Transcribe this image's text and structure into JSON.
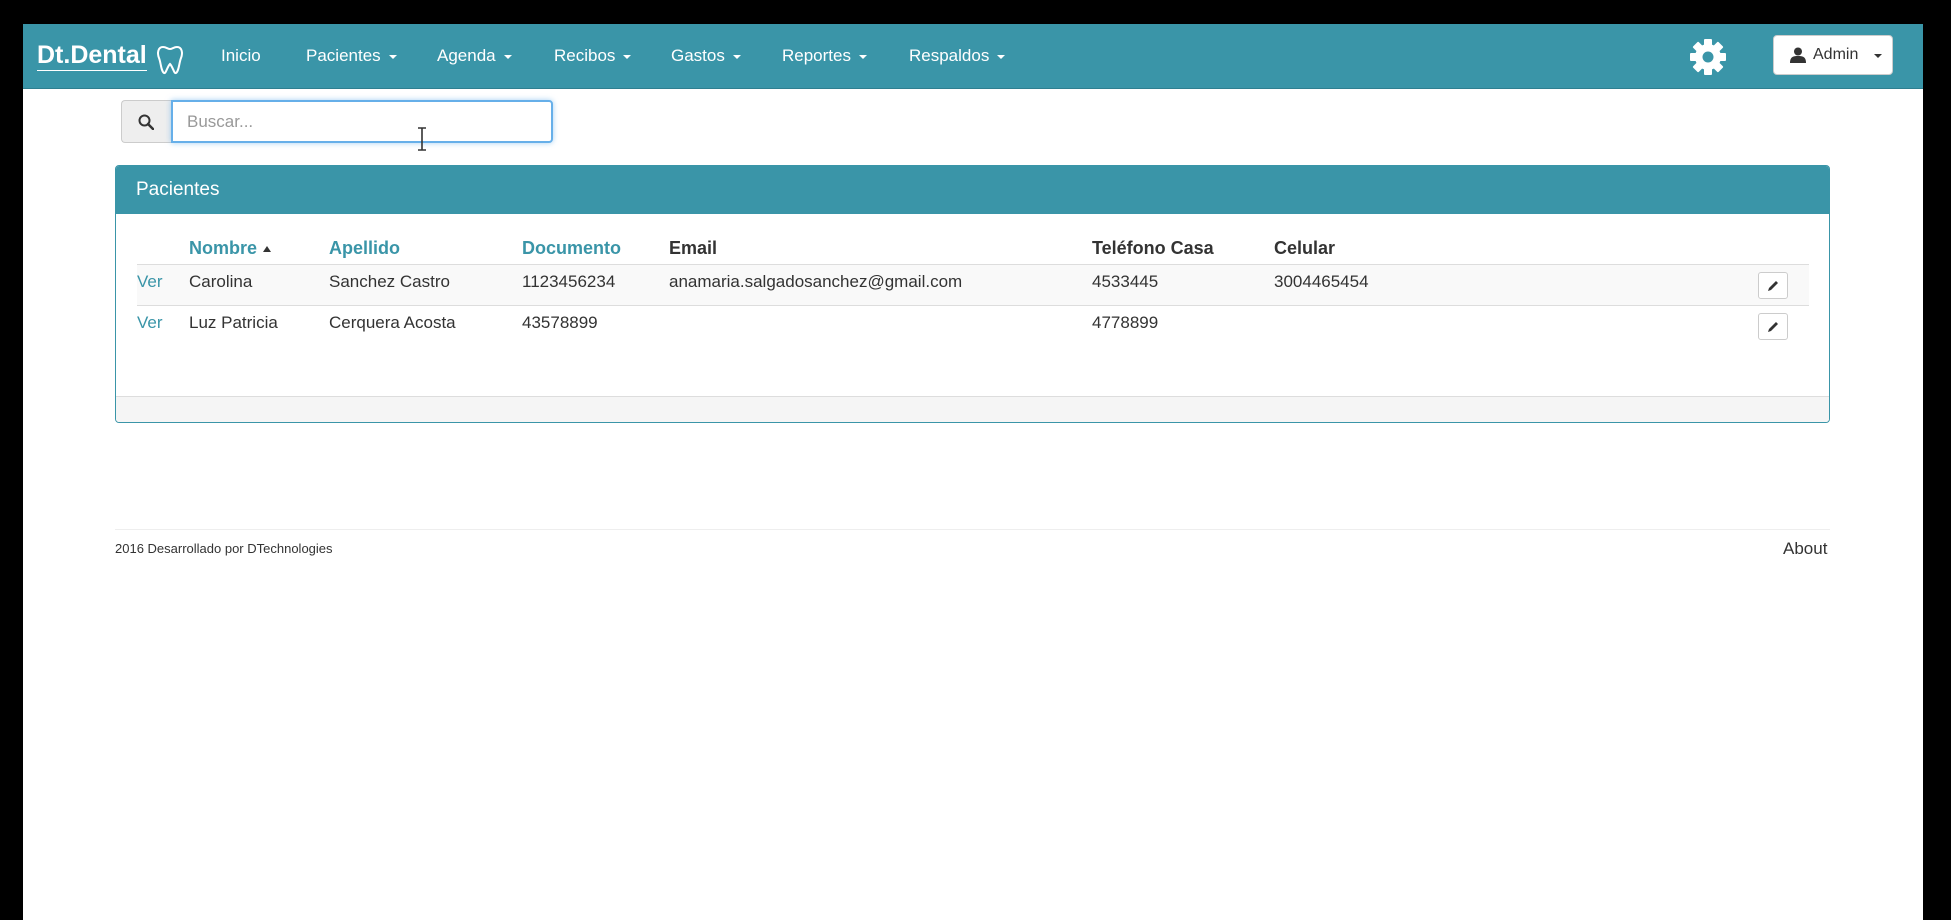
{
  "navbar": {
    "brand": "Dt.Dental",
    "items": [
      {
        "label": "Inicio",
        "dropdown": false
      },
      {
        "label": "Pacientes",
        "dropdown": true
      },
      {
        "label": "Agenda",
        "dropdown": true
      },
      {
        "label": "Recibos",
        "dropdown": true
      },
      {
        "label": "Gastos",
        "dropdown": true
      },
      {
        "label": "Reportes",
        "dropdown": true
      },
      {
        "label": "Respaldos",
        "dropdown": true
      }
    ],
    "settings_icon": "gear-icon",
    "user_menu": {
      "label": "Admin",
      "icon": "user-icon"
    }
  },
  "search": {
    "placeholder": "Buscar...",
    "value": "",
    "icon": "search-icon"
  },
  "panel": {
    "title": "Pacientes",
    "columns": {
      "nombre": "Nombre",
      "apellido": "Apellido",
      "documento": "Documento",
      "email": "Email",
      "telefono": "Teléfono Casa",
      "celular": "Celular"
    },
    "rows": [
      {
        "action": "Ver",
        "nombre": "Carolina",
        "apellido": "Sanchez Castro",
        "documento": "1123456234",
        "email": "anamaria.salgadosanchez@gmail.com",
        "telefono": "4533445",
        "celular": "3004465454"
      },
      {
        "action": "Ver",
        "nombre": "Luz Patricia",
        "apellido": "Cerquera Acosta",
        "documento": "43578899",
        "email": "",
        "telefono": "4778899",
        "celular": ""
      }
    ]
  },
  "footer": {
    "text": "2016 Desarrollado por DTechnologies",
    "about": "About"
  },
  "colors": {
    "accent": "#3a95a8"
  }
}
